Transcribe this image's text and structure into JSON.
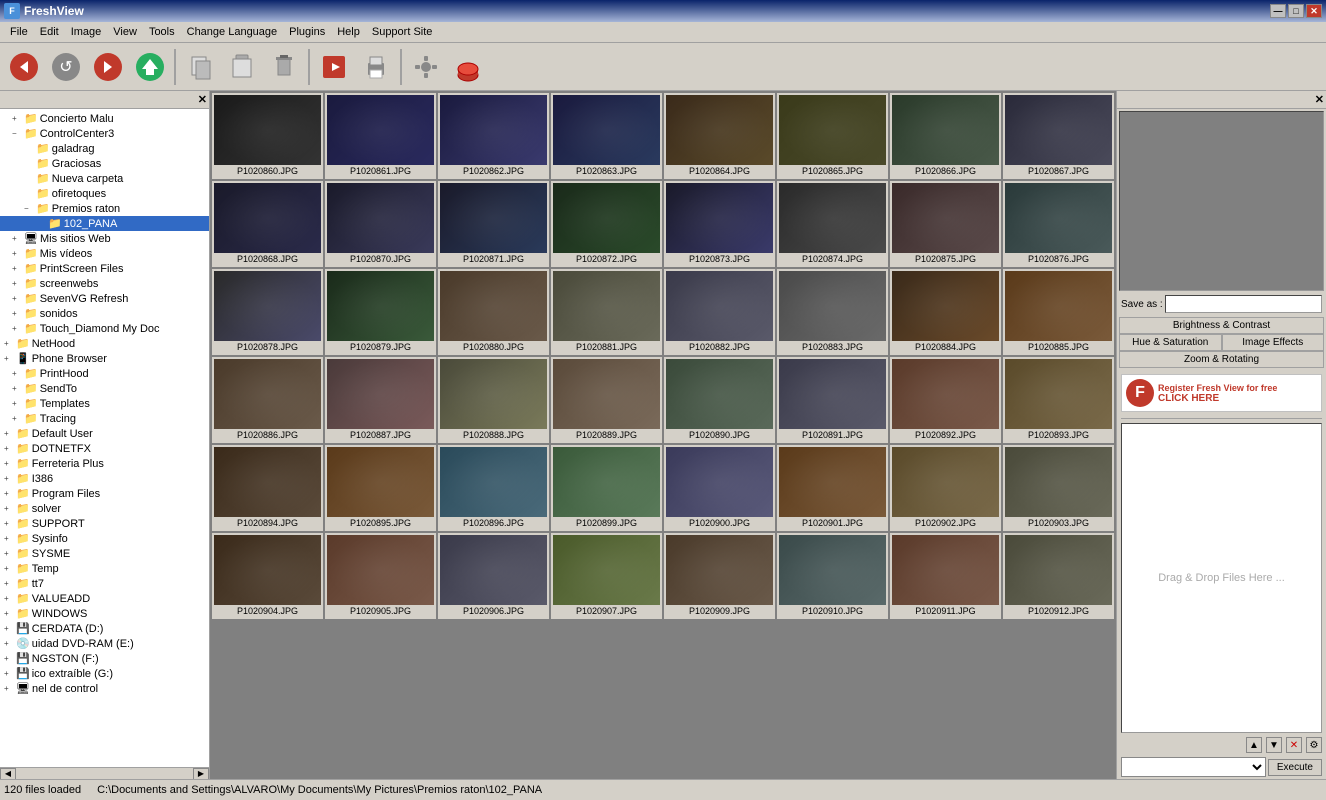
{
  "app": {
    "title": "FreshView",
    "icon": "F"
  },
  "title_buttons": {
    "minimize": "—",
    "maximize": "□",
    "close": "✕"
  },
  "menu": {
    "items": [
      "File",
      "Edit",
      "Image",
      "View",
      "Tools",
      "Change Language",
      "Plugins",
      "Help",
      "Support Site"
    ]
  },
  "toolbar": {
    "buttons": [
      {
        "name": "back",
        "icon": "◀"
      },
      {
        "name": "refresh",
        "icon": "↺"
      },
      {
        "name": "forward",
        "icon": "▶"
      },
      {
        "name": "home",
        "icon": "⌂"
      },
      {
        "name": "copy",
        "icon": "⧉"
      },
      {
        "name": "paste",
        "icon": "📋"
      },
      {
        "name": "delete",
        "icon": "🗑"
      },
      {
        "name": "slideshow",
        "icon": "▶"
      },
      {
        "name": "print",
        "icon": "🖨"
      },
      {
        "name": "settings",
        "icon": "⚙"
      },
      {
        "name": "trash",
        "icon": "🗑"
      }
    ]
  },
  "left_panel": {
    "close_icon": "✕",
    "tree": [
      {
        "label": "Concierto Malu",
        "indent": 1,
        "expanded": false,
        "icon": "📁"
      },
      {
        "label": "ControlCenter3",
        "indent": 1,
        "expanded": true,
        "icon": "📁"
      },
      {
        "label": "galadrag",
        "indent": 2,
        "expanded": false,
        "icon": "📁"
      },
      {
        "label": "Graciosas",
        "indent": 2,
        "expanded": false,
        "icon": "📁"
      },
      {
        "label": "Nueva carpeta",
        "indent": 2,
        "expanded": false,
        "icon": "📁"
      },
      {
        "label": "ofiretoques",
        "indent": 2,
        "expanded": false,
        "icon": "📁"
      },
      {
        "label": "Premios raton",
        "indent": 2,
        "expanded": true,
        "icon": "📁"
      },
      {
        "label": "102_PANA",
        "indent": 3,
        "selected": true,
        "icon": "📁"
      },
      {
        "label": "Mis sitios Web",
        "indent": 1,
        "expanded": false,
        "icon": "🖥"
      },
      {
        "label": "Mis vídeos",
        "indent": 1,
        "expanded": false,
        "icon": "📁"
      },
      {
        "label": "PrintScreen Files",
        "indent": 1,
        "expanded": false,
        "icon": "📁"
      },
      {
        "label": "screenwebs",
        "indent": 1,
        "expanded": false,
        "icon": "📁"
      },
      {
        "label": "SevenVG Refresh",
        "indent": 1,
        "expanded": false,
        "icon": "📁"
      },
      {
        "label": "sonidos",
        "indent": 1,
        "expanded": false,
        "icon": "📁"
      },
      {
        "label": "Touch_Diamond My Doc",
        "indent": 1,
        "expanded": false,
        "icon": "📁"
      },
      {
        "label": "NetHood",
        "indent": 0,
        "expanded": false,
        "icon": "📁"
      },
      {
        "label": "Phone Browser",
        "indent": 0,
        "expanded": false,
        "icon": "📱"
      },
      {
        "label": "PrintHood",
        "indent": 1,
        "expanded": false,
        "icon": "📁"
      },
      {
        "label": "SendTo",
        "indent": 1,
        "expanded": false,
        "icon": "📁"
      },
      {
        "label": "Templates",
        "indent": 1,
        "expanded": false,
        "icon": "📁"
      },
      {
        "label": "Tracing",
        "indent": 1,
        "expanded": false,
        "icon": "📁"
      },
      {
        "label": "Default User",
        "indent": 0,
        "expanded": false,
        "icon": "📁"
      },
      {
        "label": "DOTNETFX",
        "indent": 0,
        "expanded": false,
        "icon": "📁"
      },
      {
        "label": "Ferreteria Plus",
        "indent": 0,
        "expanded": false,
        "icon": "📁"
      },
      {
        "label": "I386",
        "indent": 0,
        "expanded": false,
        "icon": "📁"
      },
      {
        "label": "Program Files",
        "indent": 0,
        "expanded": false,
        "icon": "📁"
      },
      {
        "label": "solver",
        "indent": 0,
        "expanded": false,
        "icon": "📁"
      },
      {
        "label": "SUPPORT",
        "indent": 0,
        "expanded": false,
        "icon": "📁"
      },
      {
        "label": "Sysinfo",
        "indent": 0,
        "expanded": false,
        "icon": "📁"
      },
      {
        "label": "SYSME",
        "indent": 0,
        "expanded": false,
        "icon": "📁"
      },
      {
        "label": "Temp",
        "indent": 0,
        "expanded": false,
        "icon": "📁"
      },
      {
        "label": "tt7",
        "indent": 0,
        "expanded": false,
        "icon": "📁"
      },
      {
        "label": "VALUEADD",
        "indent": 0,
        "expanded": false,
        "icon": "📁"
      },
      {
        "label": "WINDOWS",
        "indent": 0,
        "expanded": false,
        "icon": "📁"
      },
      {
        "label": "CERDATA (D:)",
        "indent": 0,
        "expanded": false,
        "icon": "💾"
      },
      {
        "label": "uidad DVD-RAM (E:)",
        "indent": 0,
        "expanded": false,
        "icon": "💿"
      },
      {
        "label": "NGSTON (F:)",
        "indent": 0,
        "expanded": false,
        "icon": "💾"
      },
      {
        "label": "ico extraíble (G:)",
        "indent": 0,
        "expanded": false,
        "icon": "💾"
      },
      {
        "label": "nel de control",
        "indent": 0,
        "expanded": false,
        "icon": "🖥"
      }
    ]
  },
  "thumbnails": [
    {
      "name": "P1020860.JPG",
      "color": "photo-dark"
    },
    {
      "name": "P1020861.JPG",
      "color": "photo-stage"
    },
    {
      "name": "P1020862.JPG",
      "color": "photo-stage"
    },
    {
      "name": "P1020863.JPG",
      "color": "photo-stage"
    },
    {
      "name": "P1020864.JPG",
      "color": "photo-crowd"
    },
    {
      "name": "P1020865.JPG",
      "color": "photo-crowd"
    },
    {
      "name": "P1020866.JPG",
      "color": "photo-crowd"
    },
    {
      "name": "P1020867.JPG",
      "color": "photo-crowd"
    },
    {
      "name": "P1020868.JPG",
      "color": "photo-stage"
    },
    {
      "name": "P1020870.JPG",
      "color": "photo-stage"
    },
    {
      "name": "P1020871.JPG",
      "color": "photo-stage"
    },
    {
      "name": "P1020872.JPG",
      "color": "photo-stage"
    },
    {
      "name": "P1020873.JPG",
      "color": "photo-stage"
    },
    {
      "name": "P1020874.JPG",
      "color": "photo-stage"
    },
    {
      "name": "P1020875.JPG",
      "color": "photo-crowd"
    },
    {
      "name": "P1020876.JPG",
      "color": "photo-crowd"
    },
    {
      "name": "P1020878.JPG",
      "color": "photo-crowd"
    },
    {
      "name": "P1020879.JPG",
      "color": "photo-crowd"
    },
    {
      "name": "P1020880.JPG",
      "color": "photo-person"
    },
    {
      "name": "P1020881.JPG",
      "color": "photo-person"
    },
    {
      "name": "P1020882.JPG",
      "color": "photo-person"
    },
    {
      "name": "P1020883.JPG",
      "color": "photo-person"
    },
    {
      "name": "P1020884.JPG",
      "color": "photo-person"
    },
    {
      "name": "P1020885.JPG",
      "color": "photo-warm"
    },
    {
      "name": "P1020886.JPG",
      "color": "photo-person"
    },
    {
      "name": "P1020887.JPG",
      "color": "photo-person"
    },
    {
      "name": "P1020888.JPG",
      "color": "photo-person"
    },
    {
      "name": "P1020889.JPG",
      "color": "photo-person"
    },
    {
      "name": "P1020890.JPG",
      "color": "photo-person"
    },
    {
      "name": "P1020891.JPG",
      "color": "photo-person"
    },
    {
      "name": "P1020892.JPG",
      "color": "photo-warm"
    },
    {
      "name": "P1020893.JPG",
      "color": "photo-warm"
    },
    {
      "name": "P1020894.JPG",
      "color": "photo-person"
    },
    {
      "name": "P1020895.JPG",
      "color": "photo-warm"
    },
    {
      "name": "P1020896.JPG",
      "color": "photo-outdoor"
    },
    {
      "name": "P1020899.JPG",
      "color": "photo-outdoor"
    },
    {
      "name": "P1020900.JPG",
      "color": "photo-outdoor"
    },
    {
      "name": "P1020901.JPG",
      "color": "photo-warm"
    },
    {
      "name": "P1020902.JPG",
      "color": "photo-warm"
    },
    {
      "name": "P1020903.JPG",
      "color": "photo-warm"
    },
    {
      "name": "P1020904.JPG",
      "color": "photo-person"
    },
    {
      "name": "P1020905.JPG",
      "color": "photo-warm"
    },
    {
      "name": "P1020906.JPG",
      "color": "photo-crowd"
    },
    {
      "name": "P1020907.JPG",
      "color": "photo-outdoor"
    },
    {
      "name": "P1020909.JPG",
      "color": "photo-person"
    },
    {
      "name": "P1020910.JPG",
      "color": "photo-crowd"
    },
    {
      "name": "P1020911.JPG",
      "color": "photo-warm"
    },
    {
      "name": "P1020912.JPG",
      "color": "photo-warm"
    }
  ],
  "right_panel": {
    "close_icon": "✕",
    "save_label": "Save as :",
    "save_input_placeholder": "",
    "tabs": {
      "brightness_contrast": "Brightness & Contrast",
      "hue_saturation": "Hue & Saturation",
      "image_effects": "Image Effects",
      "zoom_rotating": "Zoom & Rotating"
    },
    "ad": {
      "icon": "F",
      "line1": "Register Fresh View for free",
      "line2": "CLICK HERE"
    },
    "drop_text": "Drag & Drop Files Here ...",
    "controls": {
      "up": "▲",
      "down": "▼",
      "delete": "✕",
      "settings": "⚙"
    },
    "execute_btn": "Execute"
  },
  "status_bar": {
    "files_loaded": "120 files loaded",
    "path": "C:\\Documents and Settings\\ALVARO\\My Documents\\My Pictures\\Premios raton\\102_PANA"
  }
}
